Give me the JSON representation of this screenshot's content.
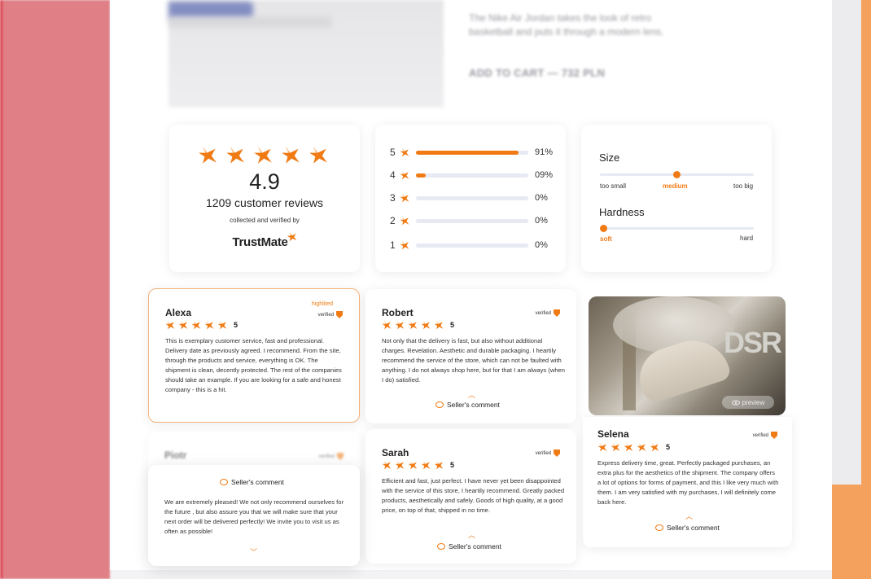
{
  "hero": {
    "description": "The Nike Air Jordan takes the look of retro basketball and puts it through a modern lens.",
    "add_to_cart": "ADD TO CART —",
    "price": "732 PLN"
  },
  "summary": {
    "rating": "4.9",
    "reviews": "1209 customer reviews",
    "collected": "collected and verified by",
    "brand": "TrustMate"
  },
  "distribution": [
    {
      "star": "5",
      "percent_label": "91%",
      "fraction": 0.91
    },
    {
      "star": "4",
      "percent_label": "09%",
      "fraction": 0.09
    },
    {
      "star": "3",
      "percent_label": "0%",
      "fraction": 0
    },
    {
      "star": "2",
      "percent_label": "0%",
      "fraction": 0
    },
    {
      "star": "1",
      "percent_label": "0%",
      "fraction": 0
    }
  ],
  "fit": {
    "size": {
      "title": "Size",
      "low": "too small",
      "mid": "medium",
      "high": "too big",
      "value": 0.5
    },
    "hardness": {
      "title": "Hardness",
      "low": "soft",
      "high": "hard",
      "value": 0.0
    }
  },
  "reviews": {
    "alexa": {
      "name": "Alexa",
      "score": "5",
      "tag": "highlited",
      "verified": "verified",
      "text": "This is exemplary customer service, fast and professional. Delivery date as previously agreed. I recommend. From the site, through the products and service, everything is OK. The shipment is clean, decently protected. The rest of the companies should take an example. If you are looking for a safe and honest company - this is a hit."
    },
    "robert": {
      "name": "Robert",
      "score": "5",
      "verified": "verified",
      "text": "Not only that the delivery is fast, but also without additional charges. Revelation. Aesthetic and durable packaging. I heartily recommend the service of the store, which can not be faulted with anything. I do not always shop here, but for that I am always (when I do) satisfied.",
      "seller": "Seller's comment"
    },
    "piotr": {
      "name": "Piotr",
      "verified": "verified"
    },
    "piotr_comment": {
      "title": "Seller's comment",
      "text": "We are extremely pleased! We not only recommend ourselves for the future , but also assure you that we will make sure that your next order will be delivered perfectly! We invite you to visit us as often as possible!"
    },
    "sarah": {
      "name": "Sarah",
      "score": "5",
      "verified": "verified",
      "text": "Efficient and fast, just perfect. I have never yet been disappointed with the service of this store, I heartily recommend. Greatly packed products, aesthetically and safely. Goods of high quality, at a good price, on top of that, shipped in no time.",
      "seller": "Seller's comment"
    },
    "selena": {
      "name": "Selena",
      "score": "5",
      "verified": "verified",
      "preview": "preview",
      "photo_text": "DSR",
      "text": "Express delivery time, great. Perfectly packaged purchases, an extra plus for the aesthetics of the shipment. The company offers a lot of options for forms of payment, and this I like very much with them. I am very satisfied with my purchases, I will definitely come back here.",
      "seller": "Seller's comment"
    }
  },
  "colors": {
    "accent": "#f07b15",
    "track": "#e7e9f3",
    "left_band": "#e07f85",
    "right_band": "#f3a15d"
  },
  "icons": [
    "star-icon",
    "shield-icon",
    "comment-icon",
    "chevron-up-icon",
    "chevron-down-icon",
    "eye-icon"
  ]
}
